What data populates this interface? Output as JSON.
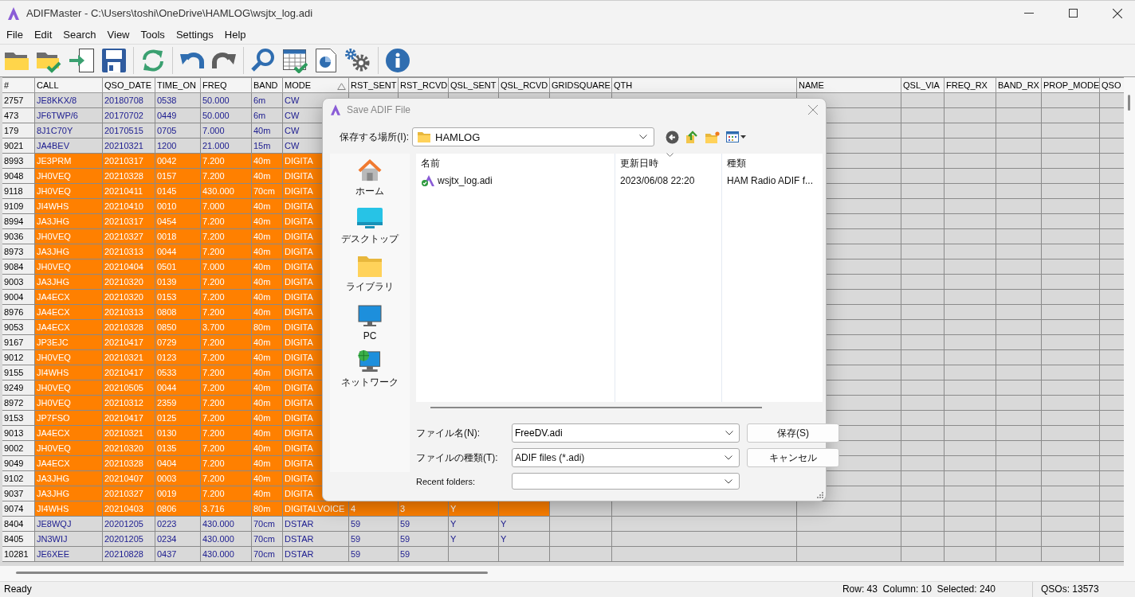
{
  "window": {
    "title": "ADIFMaster - C:\\Users\\toshi\\OneDrive\\HAMLOG\\wsjtx_log.adi"
  },
  "menu": [
    "File",
    "Edit",
    "Search",
    "View",
    "Tools",
    "Settings",
    "Help"
  ],
  "table": {
    "columns": [
      {
        "label": "#",
        "sorted": false
      },
      {
        "label": "CALL",
        "sorted": false
      },
      {
        "label": "QSO_DATE",
        "sorted": false
      },
      {
        "label": "TIME_ON",
        "sorted": false
      },
      {
        "label": "FREQ",
        "sorted": false
      },
      {
        "label": "BAND",
        "sorted": false
      },
      {
        "label": "MODE",
        "sorted": true
      },
      {
        "label": "RST_SENT",
        "sorted": false
      },
      {
        "label": "RST_RCVD",
        "sorted": false
      },
      {
        "label": "QSL_SENT",
        "sorted": false
      },
      {
        "label": "QSL_RCVD",
        "sorted": false
      },
      {
        "label": "GRIDSQUARE",
        "sorted": false
      },
      {
        "label": "QTH",
        "sorted": false
      },
      {
        "label": "NAME",
        "sorted": false
      },
      {
        "label": "QSL_VIA",
        "sorted": false
      },
      {
        "label": "FREQ_RX",
        "sorted": false
      },
      {
        "label": "BAND_RX",
        "sorted": false
      },
      {
        "label": "PROP_MODE",
        "sorted": false
      },
      {
        "label": "QSO",
        "sorted": false
      }
    ],
    "rows": [
      {
        "selected": false,
        "cells": [
          "2757",
          "JE8KKX/8",
          "20180708",
          "0538",
          "50.000",
          "6m",
          "CW"
        ]
      },
      {
        "selected": false,
        "cells": [
          "473",
          "JF6TWP/6",
          "20170702",
          "0449",
          "50.000",
          "6m",
          "CW"
        ]
      },
      {
        "selected": false,
        "cells": [
          "179",
          "8J1C70Y",
          "20170515",
          "0705",
          "7.000",
          "40m",
          "CW"
        ]
      },
      {
        "selected": false,
        "cells": [
          "9021",
          "JA4BEV",
          "20210321",
          "1200",
          "21.000",
          "15m",
          "CW"
        ]
      },
      {
        "selected": true,
        "cells": [
          "8993",
          "JE3PRM",
          "20210317",
          "0042",
          "7.200",
          "40m",
          "DIGITA"
        ]
      },
      {
        "selected": true,
        "cells": [
          "9048",
          "JH0VEQ",
          "20210328",
          "0157",
          "7.200",
          "40m",
          "DIGITA"
        ]
      },
      {
        "selected": true,
        "cells": [
          "9118",
          "JH0VEQ",
          "20210411",
          "0145",
          "430.000",
          "70cm",
          "DIGITA"
        ]
      },
      {
        "selected": true,
        "cells": [
          "9109",
          "JI4WHS",
          "20210410",
          "0010",
          "7.000",
          "40m",
          "DIGITA"
        ]
      },
      {
        "selected": true,
        "cells": [
          "8994",
          "JA3JHG",
          "20210317",
          "0454",
          "7.200",
          "40m",
          "DIGITA"
        ]
      },
      {
        "selected": true,
        "cells": [
          "9036",
          "JH0VEQ",
          "20210327",
          "0018",
          "7.200",
          "40m",
          "DIGITA"
        ]
      },
      {
        "selected": true,
        "cells": [
          "8973",
          "JA3JHG",
          "20210313",
          "0044",
          "7.200",
          "40m",
          "DIGITA"
        ]
      },
      {
        "selected": true,
        "cells": [
          "9084",
          "JH0VEQ",
          "20210404",
          "0501",
          "7.000",
          "40m",
          "DIGITA"
        ]
      },
      {
        "selected": true,
        "cells": [
          "9003",
          "JA3JHG",
          "20210320",
          "0139",
          "7.200",
          "40m",
          "DIGITA"
        ]
      },
      {
        "selected": true,
        "cells": [
          "9004",
          "JA4ECX",
          "20210320",
          "0153",
          "7.200",
          "40m",
          "DIGITA"
        ]
      },
      {
        "selected": true,
        "cells": [
          "8976",
          "JA4ECX",
          "20210313",
          "0808",
          "7.200",
          "40m",
          "DIGITA"
        ]
      },
      {
        "selected": true,
        "cells": [
          "9053",
          "JA4ECX",
          "20210328",
          "0850",
          "3.700",
          "80m",
          "DIGITA"
        ]
      },
      {
        "selected": true,
        "cells": [
          "9167",
          "JP3EJC",
          "20210417",
          "0729",
          "7.200",
          "40m",
          "DIGITA"
        ]
      },
      {
        "selected": true,
        "cells": [
          "9012",
          "JH0VEQ",
          "20210321",
          "0123",
          "7.200",
          "40m",
          "DIGITA"
        ]
      },
      {
        "selected": true,
        "cells": [
          "9155",
          "JI4WHS",
          "20210417",
          "0533",
          "7.200",
          "40m",
          "DIGITA"
        ]
      },
      {
        "selected": true,
        "cells": [
          "9249",
          "JH0VEQ",
          "20210505",
          "0044",
          "7.200",
          "40m",
          "DIGITA"
        ]
      },
      {
        "selected": true,
        "cells": [
          "8972",
          "JH0VEQ",
          "20210312",
          "2359",
          "7.200",
          "40m",
          "DIGITA"
        ]
      },
      {
        "selected": true,
        "cells": [
          "9153",
          "JP7FSO",
          "20210417",
          "0125",
          "7.200",
          "40m",
          "DIGITA"
        ]
      },
      {
        "selected": true,
        "cells": [
          "9013",
          "JA4ECX",
          "20210321",
          "0130",
          "7.200",
          "40m",
          "DIGITA"
        ]
      },
      {
        "selected": true,
        "cells": [
          "9002",
          "JH0VEQ",
          "20210320",
          "0135",
          "7.200",
          "40m",
          "DIGITA"
        ]
      },
      {
        "selected": true,
        "cells": [
          "9049",
          "JA4ECX",
          "20210328",
          "0404",
          "7.200",
          "40m",
          "DIGITA"
        ]
      },
      {
        "selected": true,
        "cells": [
          "9102",
          "JA3JHG",
          "20210407",
          "0003",
          "7.200",
          "40m",
          "DIGITA"
        ]
      },
      {
        "selected": true,
        "cells": [
          "9037",
          "JA3JHG",
          "20210327",
          "0019",
          "7.200",
          "40m",
          "DIGITA"
        ]
      },
      {
        "selected": true,
        "cells": [
          "9074",
          "JI4WHS",
          "20210403",
          "0806",
          "3.716",
          "80m",
          "DIGITALVOICE",
          "4",
          "3",
          "Y"
        ]
      },
      {
        "selected": false,
        "cells": [
          "8404",
          "JE8WQJ",
          "20201205",
          "0223",
          "430.000",
          "70cm",
          "DSTAR",
          "59",
          "59",
          "Y",
          "Y"
        ]
      },
      {
        "selected": false,
        "cells": [
          "8405",
          "JN3WIJ",
          "20201205",
          "0234",
          "430.000",
          "70cm",
          "DSTAR",
          "59",
          "59",
          "Y",
          "Y"
        ]
      },
      {
        "selected": false,
        "cells": [
          "10281",
          "JE6XEE",
          "20210828",
          "0437",
          "430.000",
          "70cm",
          "DSTAR",
          "59",
          "59"
        ]
      }
    ]
  },
  "dialog": {
    "title": "Save ADIF File",
    "location": {
      "label": "保存する場所(I):",
      "value": "HAMLOG"
    },
    "places": [
      {
        "label": "ホーム",
        "kind": "home"
      },
      {
        "label": "デスクトップ",
        "kind": "desktop"
      },
      {
        "label": "ライブラリ",
        "kind": "library"
      },
      {
        "label": "PC",
        "kind": "pc"
      },
      {
        "label": "ネットワーク",
        "kind": "network"
      }
    ],
    "list_columns": [
      {
        "label": "名前",
        "sorted": false
      },
      {
        "label": "更新日時",
        "sorted": true
      },
      {
        "label": "種類",
        "sorted": false
      }
    ],
    "files": [
      {
        "name": "wsjtx_log.adi",
        "modified": "2023/06/08 22:20",
        "type": "HAM Radio ADIF f..."
      }
    ],
    "filename": {
      "label": "ファイル名(N):",
      "value": "FreeDV.adi"
    },
    "filetype": {
      "label": "ファイルの種類(T):",
      "value": "ADIF files (*.adi)"
    },
    "recent": {
      "label": "Recent folders:"
    },
    "buttons": [
      "保存(S)",
      "キャンセル"
    ]
  },
  "status_bar": {
    "message": "Ready",
    "position": "Row: 43  Column: 10  Selected: 240",
    "count": "QSOs: 13573"
  }
}
